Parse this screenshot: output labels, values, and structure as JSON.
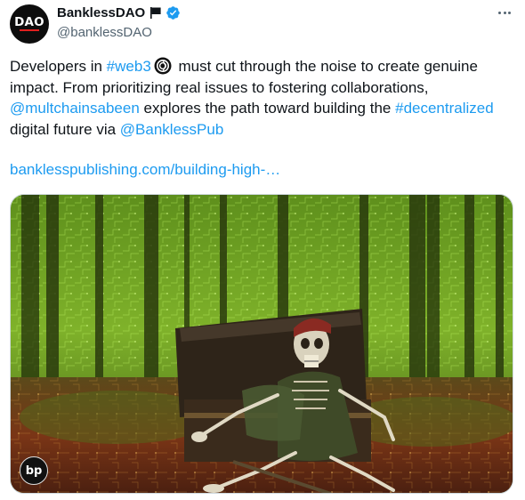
{
  "author": {
    "display_name": "BanklessDAO",
    "handle": "@banklessDAO",
    "avatar_text": "DAO",
    "icons": [
      "flag-icon",
      "verified-badge-icon"
    ]
  },
  "more_button_label": "More options",
  "tweet": {
    "line1": {
      "pre": "Developers in ",
      "hashtag": "#web3",
      "post": " must cut through the noise to create genuine"
    },
    "line2": "impact. From prioritizing real issues to fostering collaborations,",
    "line3": {
      "mention": "@multchainsabeen",
      "mid": " explores the path toward building the ",
      "hashtag": "#decentralized"
    },
    "line4": {
      "pre": "digital future via ",
      "mention": "@BanklessPub"
    },
    "url": "banklesspublishing.com/building-high-…"
  },
  "media": {
    "description_icon": "skeleton-pirate-treasure-image",
    "badge_text": "bp"
  },
  "colors": {
    "link": "#1d9bf0",
    "text": "#0f1419",
    "secondary": "#536471",
    "verified": "#1d9bf0"
  }
}
